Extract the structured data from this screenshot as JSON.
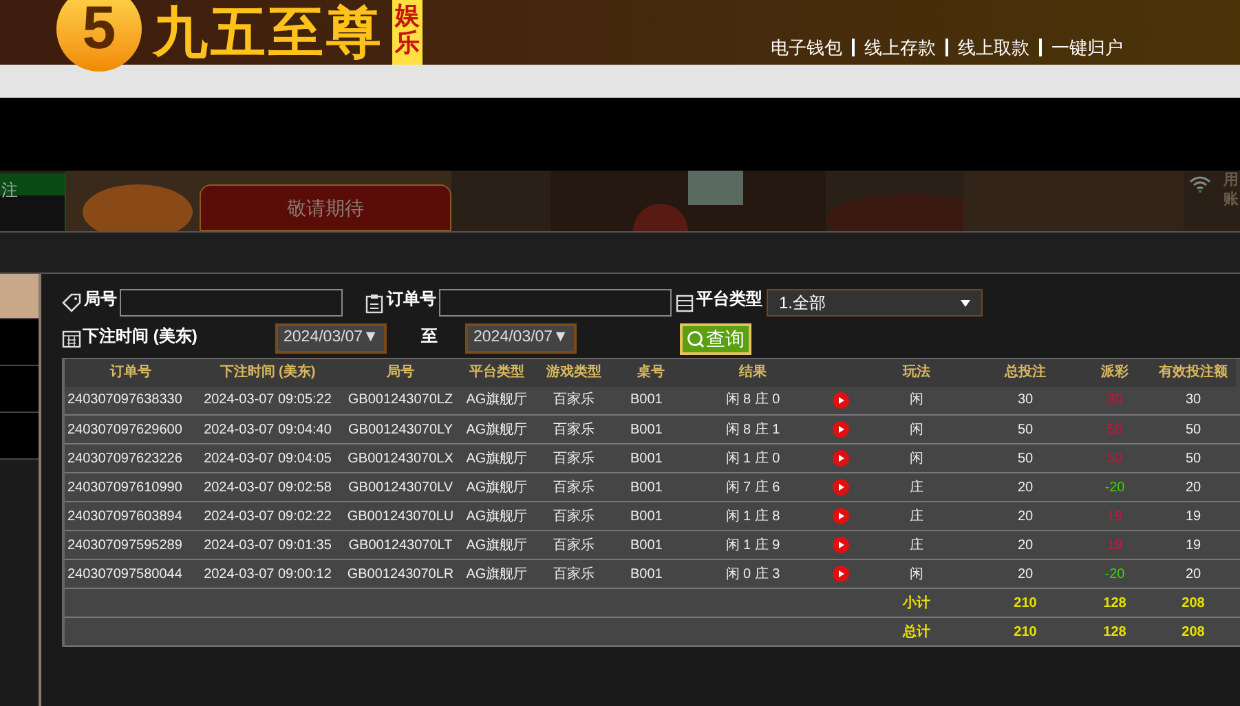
{
  "header": {
    "logo_mark": "5",
    "logo_text": "九五至尊",
    "logo_tag": "娱乐",
    "nav": [
      "电子钱包",
      "线上存款",
      "线上取款",
      "一键归户"
    ]
  },
  "banner": {
    "left_label": "注",
    "promo": "敬请期待",
    "right_text": "用账"
  },
  "sidebar": [
    {
      "selected": true
    },
    {
      "selected": false
    },
    {
      "selected": false
    },
    {
      "selected": false
    }
  ],
  "filters": {
    "round_label": "局号",
    "order_label": "订单号",
    "platform_label": "平台类型",
    "platform_value": "1.全部",
    "time_label": "下注时间 (美东)",
    "date_from": "2024/03/07▼",
    "to_label": "至",
    "date_to": "2024/03/07▼",
    "search_button": "查询"
  },
  "table": {
    "columns": [
      "订单号",
      "下注时间 (美东)",
      "局号",
      "平台类型",
      "游戏类型",
      "桌号",
      "结果",
      "玩法",
      "总投注",
      "派彩",
      "有效投注额"
    ],
    "rows": [
      {
        "order": "240307097638330",
        "time": "2024-03-07 09:05:22",
        "round": "GB001243070LZ",
        "platform": "AG旗舰厅",
        "game": "百家乐",
        "table": "B001",
        "result": "闲 8 庄 0",
        "play": "闲",
        "bet": "30",
        "payout": "30",
        "color": "#d0103a",
        "valid": "30"
      },
      {
        "order": "240307097629600",
        "time": "2024-03-07 09:04:40",
        "round": "GB001243070LY",
        "platform": "AG旗舰厅",
        "game": "百家乐",
        "table": "B001",
        "result": "闲 8 庄 1",
        "play": "闲",
        "bet": "50",
        "payout": "50",
        "color": "#d0103a",
        "valid": "50"
      },
      {
        "order": "240307097623226",
        "time": "2024-03-07 09:04:05",
        "round": "GB001243070LX",
        "platform": "AG旗舰厅",
        "game": "百家乐",
        "table": "B001",
        "result": "闲 1 庄 0",
        "play": "闲",
        "bet": "50",
        "payout": "50",
        "color": "#d0103a",
        "valid": "50"
      },
      {
        "order": "240307097610990",
        "time": "2024-03-07 09:02:58",
        "round": "GB001243070LV",
        "platform": "AG旗舰厅",
        "game": "百家乐",
        "table": "B001",
        "result": "闲 7 庄 6",
        "play": "庄",
        "bet": "20",
        "payout": "-20",
        "color": "#40d000",
        "valid": "20"
      },
      {
        "order": "240307097603894",
        "time": "2024-03-07 09:02:22",
        "round": "GB001243070LU",
        "platform": "AG旗舰厅",
        "game": "百家乐",
        "table": "B001",
        "result": "闲 1 庄 8",
        "play": "庄",
        "bet": "20",
        "payout": "19",
        "color": "#d0103a",
        "valid": "19"
      },
      {
        "order": "240307097595289",
        "time": "2024-03-07 09:01:35",
        "round": "GB001243070LT",
        "platform": "AG旗舰厅",
        "game": "百家乐",
        "table": "B001",
        "result": "闲 1 庄 9",
        "play": "庄",
        "bet": "20",
        "payout": "19",
        "color": "#d0103a",
        "valid": "19"
      },
      {
        "order": "240307097580044",
        "time": "2024-03-07 09:00:12",
        "round": "GB001243070LR",
        "platform": "AG旗舰厅",
        "game": "百家乐",
        "table": "B001",
        "result": "闲 0 庄 3",
        "play": "闲",
        "bet": "20",
        "payout": "-20",
        "color": "#40d000",
        "valid": "20"
      }
    ],
    "totals": [
      {
        "label": "小计",
        "bet": "210",
        "payout": "128",
        "valid": "208"
      },
      {
        "label": "总计",
        "bet": "210",
        "payout": "128",
        "valid": "208"
      }
    ]
  }
}
